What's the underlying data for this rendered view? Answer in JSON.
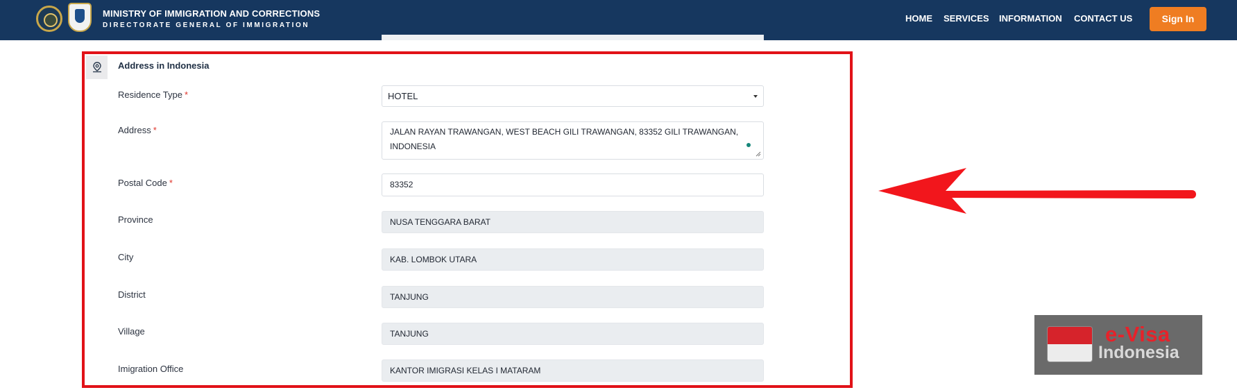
{
  "header": {
    "title": "MINISTRY OF IMMIGRATION AND CORRECTIONS",
    "subtitle": "DIRECTORATE GENERAL OF IMMIGRATION",
    "nav": [
      {
        "label": "HOME"
      },
      {
        "label": "SERVICES"
      },
      {
        "label": "INFORMATION"
      },
      {
        "label": "CONTACT US"
      }
    ],
    "signin_label": "Sign In"
  },
  "section": {
    "title": "Address in Indonesia",
    "icon": "map-pin-icon"
  },
  "form": {
    "residence_type": {
      "label": "Residence Type",
      "required": "*",
      "value": "HOTEL"
    },
    "address": {
      "label": "Address",
      "required": "*",
      "value_line1": "JALAN RAYAN TRAWANGAN, WEST BEACH GILI TRAWANGAN, 83352 GILI TRAWANGAN,",
      "value_line2": "INDONESIA"
    },
    "postal_code": {
      "label": "Postal Code",
      "required": "*",
      "value": "83352"
    },
    "province": {
      "label": "Province",
      "value": "NUSA TENGGARA BARAT"
    },
    "city": {
      "label": "City",
      "value": "KAB. LOMBOK UTARA"
    },
    "district": {
      "label": "District",
      "value": "TANJUNG"
    },
    "village": {
      "label": "Village",
      "value": "TANJUNG"
    },
    "immigration_office": {
      "label": "Imigration Office",
      "value": "KANTOR IMIGRASI KELAS I MATARAM"
    }
  },
  "watermark": {
    "line1": "e-Visa",
    "line2": "Indonesia"
  },
  "colors": {
    "navbar": "#16375f",
    "signin": "#ef7d22",
    "highlight": "#e11218",
    "arrow": "#f2161c",
    "required": "#e0352b"
  }
}
